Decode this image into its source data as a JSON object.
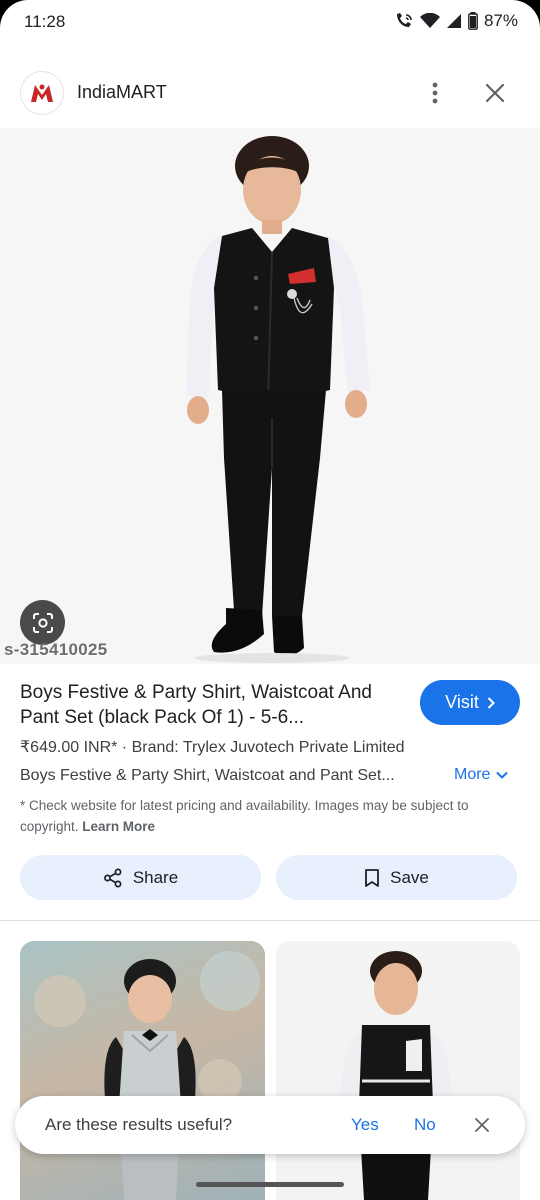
{
  "status_bar": {
    "time": "11:28",
    "battery": "87%"
  },
  "header": {
    "site_name": "IndiaMART",
    "logo_letter": "M"
  },
  "image": {
    "watermark": "s-315410025"
  },
  "product": {
    "title": "Boys Festive & Party Shirt, Waistcoat And Pant Set (black Pack Of 1) - 5-6...",
    "visit_label": "Visit",
    "price_line": "₹649.00 INR* · Brand: Trylex Juvotech Private Limited",
    "description": "Boys Festive & Party Shirt, Waistcoat and Pant Set...",
    "more_label": "More",
    "disclaimer": "* Check website for latest pricing and availability. Images may be subject to copyright.",
    "learn_more": "Learn More"
  },
  "actions": {
    "share_label": "Share",
    "save_label": "Save"
  },
  "feedback": {
    "question": "Are these results useful?",
    "yes": "Yes",
    "no": "No"
  },
  "colors": {
    "accent": "#1a73e8",
    "chip_bg": "#e8f0fe",
    "brand_red": "#c62828"
  }
}
